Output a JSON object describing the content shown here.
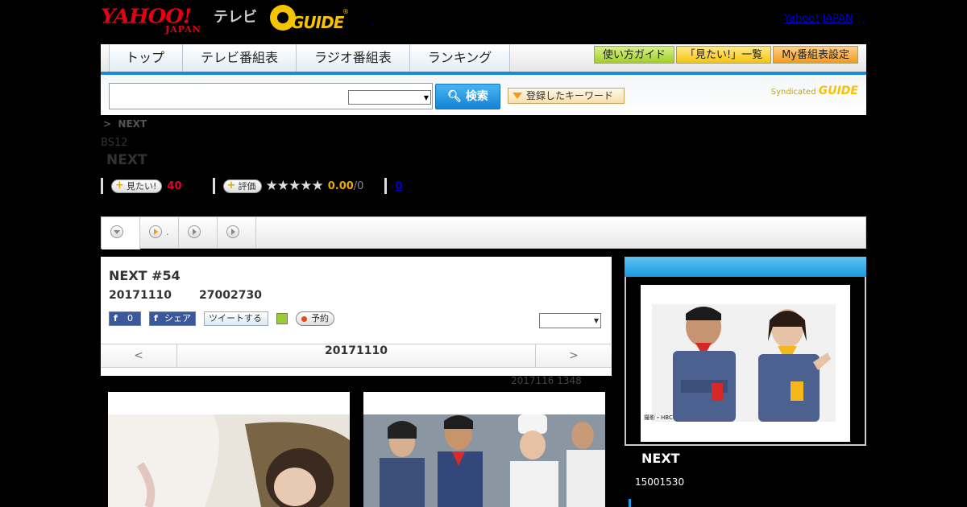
{
  "header": {
    "yahoo_logo": "YAHOO!",
    "yahoo_logo_sub": "JAPAN",
    "tv_label": "テレビ",
    "gguide_logo": "GUIDE",
    "gguide_mark": "®",
    "dot": ".",
    "yahoo_japan_link": "Yahoo! JAPAN",
    "yahoo_japan_link_dot": ","
  },
  "nav": {
    "tabs": [
      "トップ",
      "テレビ番組表",
      "ラジオ番組表",
      "ランキング"
    ],
    "buttons": [
      "使い方ガイド",
      "「見たい!」一覧",
      "My番組表設定"
    ]
  },
  "search": {
    "input_value": "",
    "select_value": "",
    "submit_label": "検索",
    "keyword_button": "登録したキーワード",
    "syndicated_label": "Syndicated",
    "syndicated_logo": "GUIDE"
  },
  "program": {
    "breadcrumb_sep": ">",
    "breadcrumb_current": "NEXT",
    "channel": "BS12",
    "title": "NEXT",
    "mitai_label": "見たい!",
    "mitai_count": "40",
    "rate_label": "評価",
    "stars": "★★★★★",
    "score": "0.00",
    "score_max": "/0",
    "reviews_link": "0"
  },
  "subtabs": {
    "episode_label": "."
  },
  "episode": {
    "title": "NEXT #54",
    "date": "20171110",
    "time": "27002730",
    "fb_count": "0",
    "fb_share": "シェア",
    "tweet": "ツイートする",
    "reserve": "予約",
    "select_value": "",
    "pager_prev": "<",
    "pager_date": "20171110",
    "pager_next": ">",
    "updated": "2017116  1348"
  },
  "sidebar": {
    "photo_credit": "撮影・HBC",
    "program_name": "NEXT",
    "time": "15001530"
  },
  "colors": {
    "accent_blue": "#1a8ad8",
    "brand_red": "#e60012",
    "gguide_yellow": "#f5c400"
  },
  "icons": {
    "search": "search-icon",
    "dropdown": "chevron-down-icon",
    "play": "play-icon",
    "facebook": "facebook-icon",
    "twitter": "twitter-icon",
    "calendar": "calendar-icon",
    "reserve": "record-dot-icon"
  }
}
